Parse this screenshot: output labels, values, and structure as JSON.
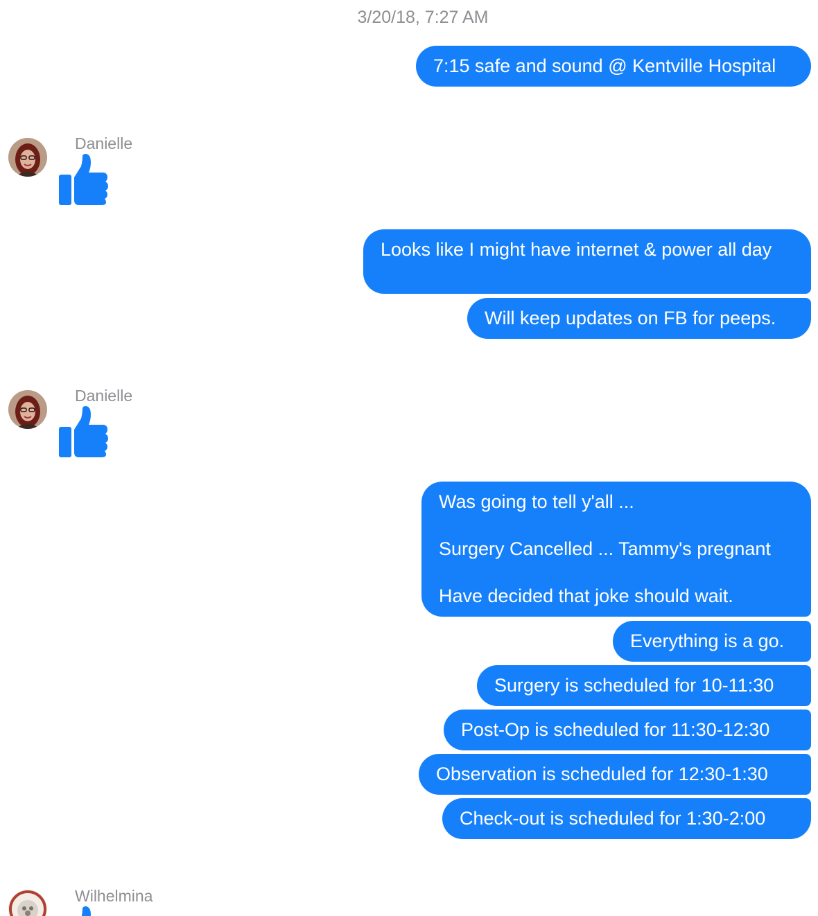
{
  "conversation": {
    "timestamp": "3/20/18, 7:27 AM",
    "colors": {
      "outgoing_bubble": "#1680fb",
      "outgoing_text": "#ffffff",
      "meta_text": "#8e8e93",
      "thumb": "#1680fb"
    },
    "outgoing_1": {
      "text": "7:15 safe and sound @ Kentville Hospital"
    },
    "reply_1": {
      "sender": "Danielle",
      "avatar_icon": "user-photo-avatar",
      "reaction_icon": "thumbs-up-icon"
    },
    "outgoing_2": [
      {
        "text": "Looks like I might have internet & power all day"
      },
      {
        "text": "Will keep updates on FB for peeps."
      }
    ],
    "reply_2": {
      "sender": "Danielle",
      "avatar_icon": "user-photo-avatar",
      "reaction_icon": "thumbs-up-icon"
    },
    "outgoing_3": [
      {
        "text": "Was going to tell y'all ...\n\nSurgery Cancelled ... Tammy's pregnant\n\nHave decided that joke should wait."
      },
      {
        "text": "Everything is a go."
      },
      {
        "text": "Surgery is scheduled for 10-11:30"
      },
      {
        "text": "Post-Op is scheduled for 11:30-12:30"
      },
      {
        "text": "Observation is scheduled for 12:30-1:30"
      },
      {
        "text": "Check-out is scheduled for 1:30-2:00"
      }
    ],
    "reply_3": {
      "sender": "Wilhelmina",
      "avatar_icon": "user-photo-avatar",
      "reaction_icon": "thumbs-up-icon"
    }
  }
}
